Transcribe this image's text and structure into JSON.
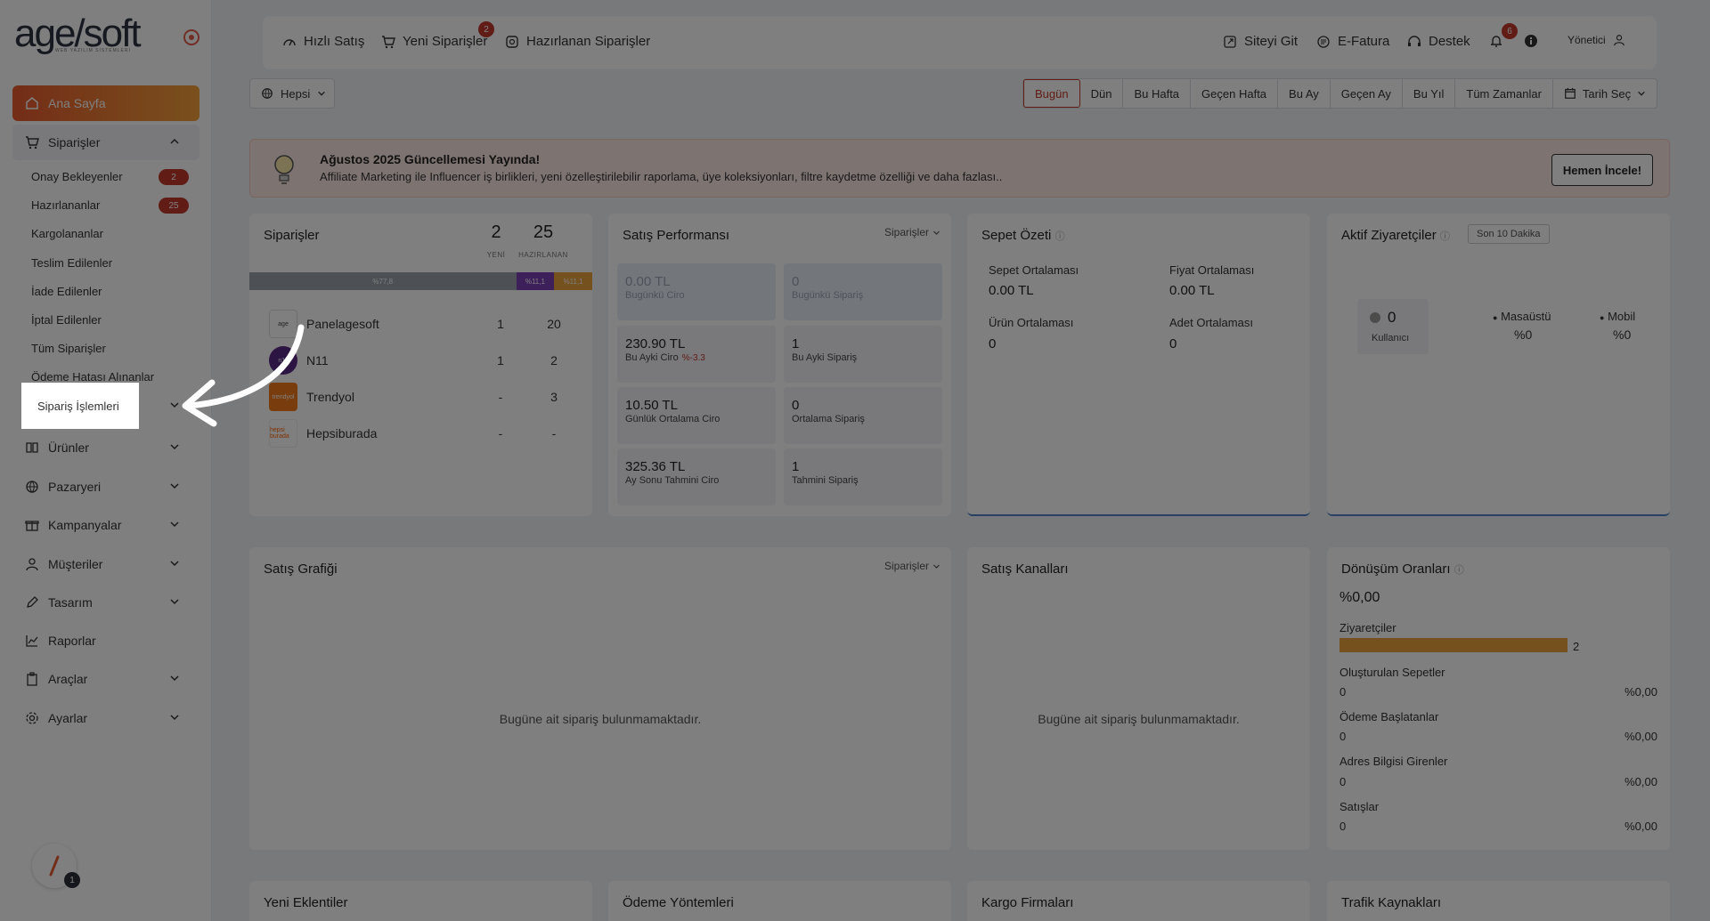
{
  "brand": {
    "logo_text": "age/soft",
    "logo_sub": "WEB YAZILIM SİSTEMLERİ"
  },
  "sidebar": {
    "home_label": "Ana Sayfa",
    "orders_label": "Siparişler",
    "order_subitems": [
      {
        "label": "Onay Bekleyenler",
        "badge": "2"
      },
      {
        "label": "Hazırlananlar",
        "badge": "25"
      },
      {
        "label": "Kargolananlar"
      },
      {
        "label": "Teslim Edilenler"
      },
      {
        "label": "İade Edilenler"
      },
      {
        "label": "İptal Edilenler"
      },
      {
        "label": "Tüm Siparişler"
      },
      {
        "label": "Ödeme Hatası Alınanlar"
      }
    ],
    "highlight_label": "Sipariş İşlemleri",
    "groups": [
      {
        "label": "Ürünler"
      },
      {
        "label": "Pazaryeri"
      },
      {
        "label": "Kampanyalar"
      },
      {
        "label": "Müşteriler"
      },
      {
        "label": "Tasarım"
      },
      {
        "label": "Raporlar"
      },
      {
        "label": "Araçlar"
      },
      {
        "label": "Ayarlar"
      }
    ],
    "avatar_badge": "1"
  },
  "header": {
    "quick_sale": "Hızlı Satış",
    "new_orders": "Yeni Siparişler",
    "new_orders_badge": "2",
    "prepared_orders": "Hazırlanan Siparişler",
    "go_site": "Siteyi Git",
    "e_invoice": "E-Fatura",
    "support": "Destek",
    "notif_badge": "6",
    "user": "Yönetici"
  },
  "filters": {
    "scope": "Hepsi",
    "ranges": [
      "Bugün",
      "Dün",
      "Bu Hafta",
      "Geçen Hafta",
      "Bu Ay",
      "Geçen Ay",
      "Bu Yıl",
      "Tüm Zamanlar"
    ],
    "active_range": "Bugün",
    "date_pick": "Tarih Seç"
  },
  "announcement": {
    "title": "Ağustos 2025 Güncellemesi Yayında!",
    "text": "Affiliate Marketing ile Influencer iş birlikleri, yeni özelleştirilebilir raporlama, üye koleksiyonları, filtre kaydetme özelliği ve daha fazlası..",
    "button": "Hemen İncele!"
  },
  "orders_card": {
    "title": "Siparişler",
    "new_count": "2",
    "new_label": "YENİ",
    "prepared_count": "25",
    "prepared_label": "HAZIRLANAN",
    "progress_labels": [
      "%77,8",
      "%11,1",
      "%11,1"
    ],
    "progress_values": [
      77.8,
      11.1,
      11.1
    ],
    "marketplaces": [
      {
        "name": "Panelagesoft",
        "new": "1",
        "prepared": "20",
        "logo": "age",
        "color": "#444444"
      },
      {
        "name": "N11",
        "new": "1",
        "prepared": "2",
        "logo": "n11",
        "color": "#5b2a86"
      },
      {
        "name": "Trendyol",
        "new": "-",
        "prepared": "3",
        "logo": "trendyol",
        "color": "#f27a1a"
      },
      {
        "name": "Hepsiburada",
        "new": "-",
        "prepared": "-",
        "logo": "hepsi burada",
        "color": "#ff6000"
      }
    ]
  },
  "sales_perf": {
    "title": "Satış Performansı",
    "dropdown": "Siparişler",
    "tiles": [
      {
        "value": "0.00 TL",
        "label": "Bugünkü Ciro"
      },
      {
        "value": "0",
        "label": "Bugünkü Sipariş"
      },
      {
        "value": "230.90 TL",
        "label": "Bu Ayki Ciro",
        "trend": "%-3.3"
      },
      {
        "value": "1",
        "label": "Bu Ayki Sipariş"
      },
      {
        "value": "10.50 TL",
        "label": "Günlük Ortalama Ciro"
      },
      {
        "value": "0",
        "label": "Ortalama Sipariş"
      },
      {
        "value": "325.36 TL",
        "label": "Ay Sonu Tahmini Ciro"
      },
      {
        "value": "1",
        "label": "Tahmini Sipariş"
      }
    ]
  },
  "cart_summary": {
    "title": "Sepet Özeti",
    "stats": [
      {
        "label": "Sepet Ortalaması",
        "value": "0.00 TL"
      },
      {
        "label": "Fiyat Ortalaması",
        "value": "0.00 TL"
      },
      {
        "label": "Ürün Ortalaması",
        "value": "0"
      },
      {
        "label": "Adet Ortalaması",
        "value": "0"
      }
    ]
  },
  "active_visitors": {
    "title": "Aktif Ziyaretçiler",
    "pill": "Son 10 Dakika",
    "users_count": "0",
    "users_label": "Kullanıcı",
    "desktop_label": "Masaüstü",
    "desktop_pct": "%0",
    "mobile_label": "Mobil",
    "mobile_pct": "%0"
  },
  "sales_chart": {
    "title": "Satış Grafiği",
    "dropdown": "Siparişler",
    "empty": "Bugüne ait sipariş bulunmamaktadır."
  },
  "sales_channels": {
    "title": "Satış Kanalları",
    "empty": "Bugüne ait sipariş bulunmamaktadır."
  },
  "conversion": {
    "title": "Dönüşüm Oranları",
    "total": "%0,00",
    "visitors_label": "Ziyaretçiler",
    "visitors_value": "2",
    "rows": [
      {
        "label": "Oluşturulan Sepetler",
        "count": "0",
        "pct": "%0,00"
      },
      {
        "label": "Ödeme Başlatanlar",
        "count": "0",
        "pct": "%0,00"
      },
      {
        "label": "Adres Bilgisi Girenler",
        "count": "0",
        "pct": "%0,00"
      },
      {
        "label": "Satışlar",
        "count": "0",
        "pct": "%0,00"
      }
    ]
  },
  "bottom_cards": {
    "new_plugins": "Yeni Eklentiler",
    "payment_methods": "Ödeme Yöntemleri",
    "cargo_firms": "Kargo Firmaları",
    "traffic_sources": "Trafik Kaynakları"
  }
}
